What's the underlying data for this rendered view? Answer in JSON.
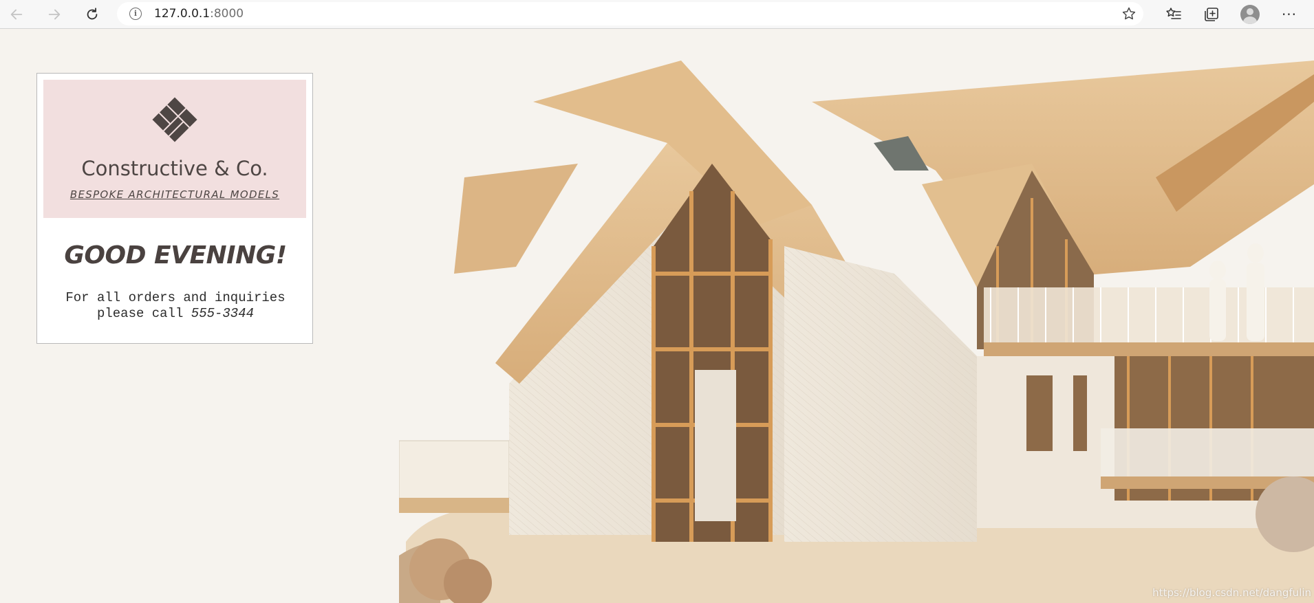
{
  "browser": {
    "url_host": "127.0.0.1",
    "url_port": ":8000",
    "icons": [
      "back-arrow-icon",
      "forward-arrow-icon",
      "refresh-icon",
      "info-icon",
      "star-icon",
      "favorites-icon",
      "collections-icon",
      "profile-icon",
      "more-icon"
    ]
  },
  "card": {
    "brand_name": "Constructive & Co.",
    "brand_tagline": "BESPOKE ARCHITECTURAL MODELS",
    "greeting": "GOOD EVENING!",
    "contact_line1": "For all orders and inquiries",
    "contact_line2_prefix": "please call ",
    "phone": "555-3344"
  },
  "watermark": "https://blog.csdn.net/dangfulin",
  "colors": {
    "page_bg": "#f6f3ee",
    "logo_bg": "#f2dfdf",
    "brand_text": "#4e4644"
  }
}
